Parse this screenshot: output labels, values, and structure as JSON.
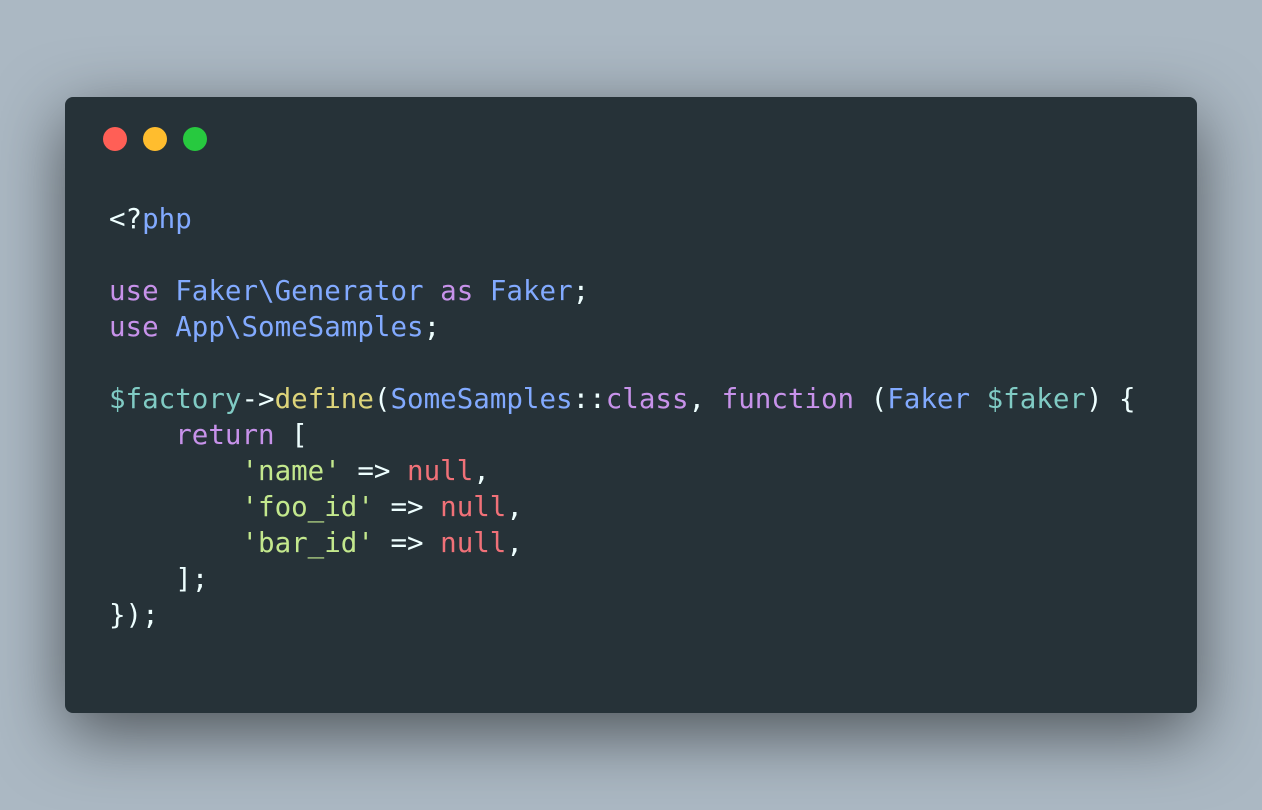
{
  "window": {
    "controls": [
      {
        "name": "close",
        "color": "#ff5f56"
      },
      {
        "name": "minimize",
        "color": "#ffbd2e"
      },
      {
        "name": "maximize",
        "color": "#27c93f"
      }
    ]
  },
  "code": {
    "language": "php",
    "lines": [
      [
        {
          "t": "<?",
          "k": "plain"
        },
        {
          "t": "php",
          "k": "tag"
        }
      ],
      [],
      [
        {
          "t": "use",
          "k": "keyword"
        },
        {
          "t": " ",
          "k": "plain"
        },
        {
          "t": "Faker\\Generator",
          "k": "class"
        },
        {
          "t": " ",
          "k": "plain"
        },
        {
          "t": "as",
          "k": "keyword"
        },
        {
          "t": " ",
          "k": "plain"
        },
        {
          "t": "Faker",
          "k": "class"
        },
        {
          "t": ";",
          "k": "plain"
        }
      ],
      [
        {
          "t": "use",
          "k": "keyword"
        },
        {
          "t": " ",
          "k": "plain"
        },
        {
          "t": "App\\SomeSamples",
          "k": "class"
        },
        {
          "t": ";",
          "k": "plain"
        }
      ],
      [],
      [
        {
          "t": "$factory",
          "k": "variable"
        },
        {
          "t": "->",
          "k": "plain"
        },
        {
          "t": "define",
          "k": "function"
        },
        {
          "t": "(",
          "k": "plain"
        },
        {
          "t": "SomeSamples",
          "k": "class"
        },
        {
          "t": "::",
          "k": "plain"
        },
        {
          "t": "class",
          "k": "keyword"
        },
        {
          "t": ", ",
          "k": "plain"
        },
        {
          "t": "function",
          "k": "keyword"
        },
        {
          "t": " (",
          "k": "plain"
        },
        {
          "t": "Faker",
          "k": "class"
        },
        {
          "t": " ",
          "k": "plain"
        },
        {
          "t": "$faker",
          "k": "variable"
        },
        {
          "t": ") {",
          "k": "plain"
        }
      ],
      [
        {
          "t": "    ",
          "k": "plain"
        },
        {
          "t": "return",
          "k": "keyword"
        },
        {
          "t": " [",
          "k": "plain"
        }
      ],
      [
        {
          "t": "        ",
          "k": "plain"
        },
        {
          "t": "'name'",
          "k": "string"
        },
        {
          "t": " => ",
          "k": "plain"
        },
        {
          "t": "null",
          "k": "null"
        },
        {
          "t": ",",
          "k": "plain"
        }
      ],
      [
        {
          "t": "        ",
          "k": "plain"
        },
        {
          "t": "'foo_id'",
          "k": "string"
        },
        {
          "t": " => ",
          "k": "plain"
        },
        {
          "t": "null",
          "k": "null"
        },
        {
          "t": ",",
          "k": "plain"
        }
      ],
      [
        {
          "t": "        ",
          "k": "plain"
        },
        {
          "t": "'bar_id'",
          "k": "string"
        },
        {
          "t": " => ",
          "k": "plain"
        },
        {
          "t": "null",
          "k": "null"
        },
        {
          "t": ",",
          "k": "plain"
        }
      ],
      [
        {
          "t": "    ];",
          "k": "plain"
        }
      ],
      [
        {
          "t": "});",
          "k": "plain"
        }
      ]
    ]
  }
}
